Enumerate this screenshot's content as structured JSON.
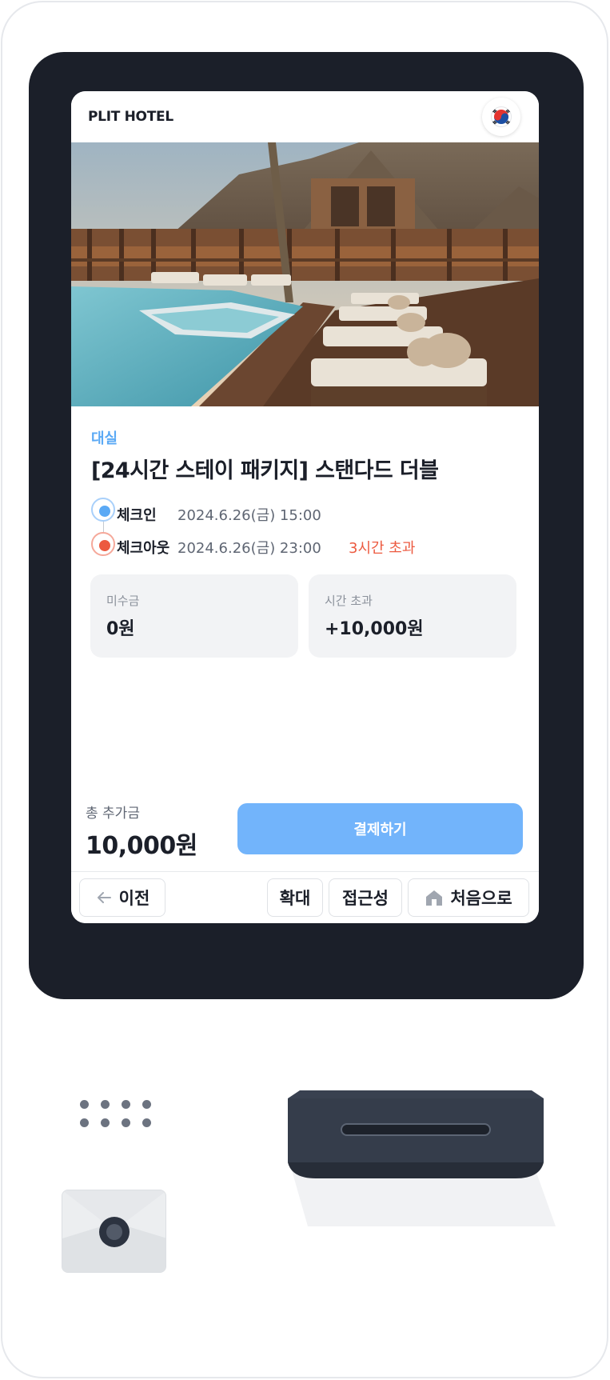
{
  "header": {
    "hotel_name": "PLIT HOTEL",
    "language_flag": "korea-flag-icon"
  },
  "room": {
    "type": "대실",
    "title": "[24시간 스테이 패키지] 스탠다드 더블"
  },
  "schedule": {
    "checkin_label": "체크인",
    "checkin_value": "2024.6.26(금) 15:00",
    "checkout_label": "체크아웃",
    "checkout_value": "2024.6.26(금) 23:00",
    "overtime_note": "3시간 초과"
  },
  "cards": [
    {
      "label": "미수금",
      "value": "0원"
    },
    {
      "label": "시간 초과",
      "value": "+10,000원"
    }
  ],
  "summary": {
    "total_label": "총 추가금",
    "total_value": "10,000원",
    "pay_label": "결제하기"
  },
  "bottom_nav": {
    "back_label": "이전",
    "zoom_label": "확대",
    "accessibility_label": "접근성",
    "home_label": "처음으로"
  },
  "colors": {
    "accent": "#72b4fb",
    "room_type": "#5aa9f5",
    "overtime": "#ec5a40",
    "bezel": "#1b1f29"
  }
}
